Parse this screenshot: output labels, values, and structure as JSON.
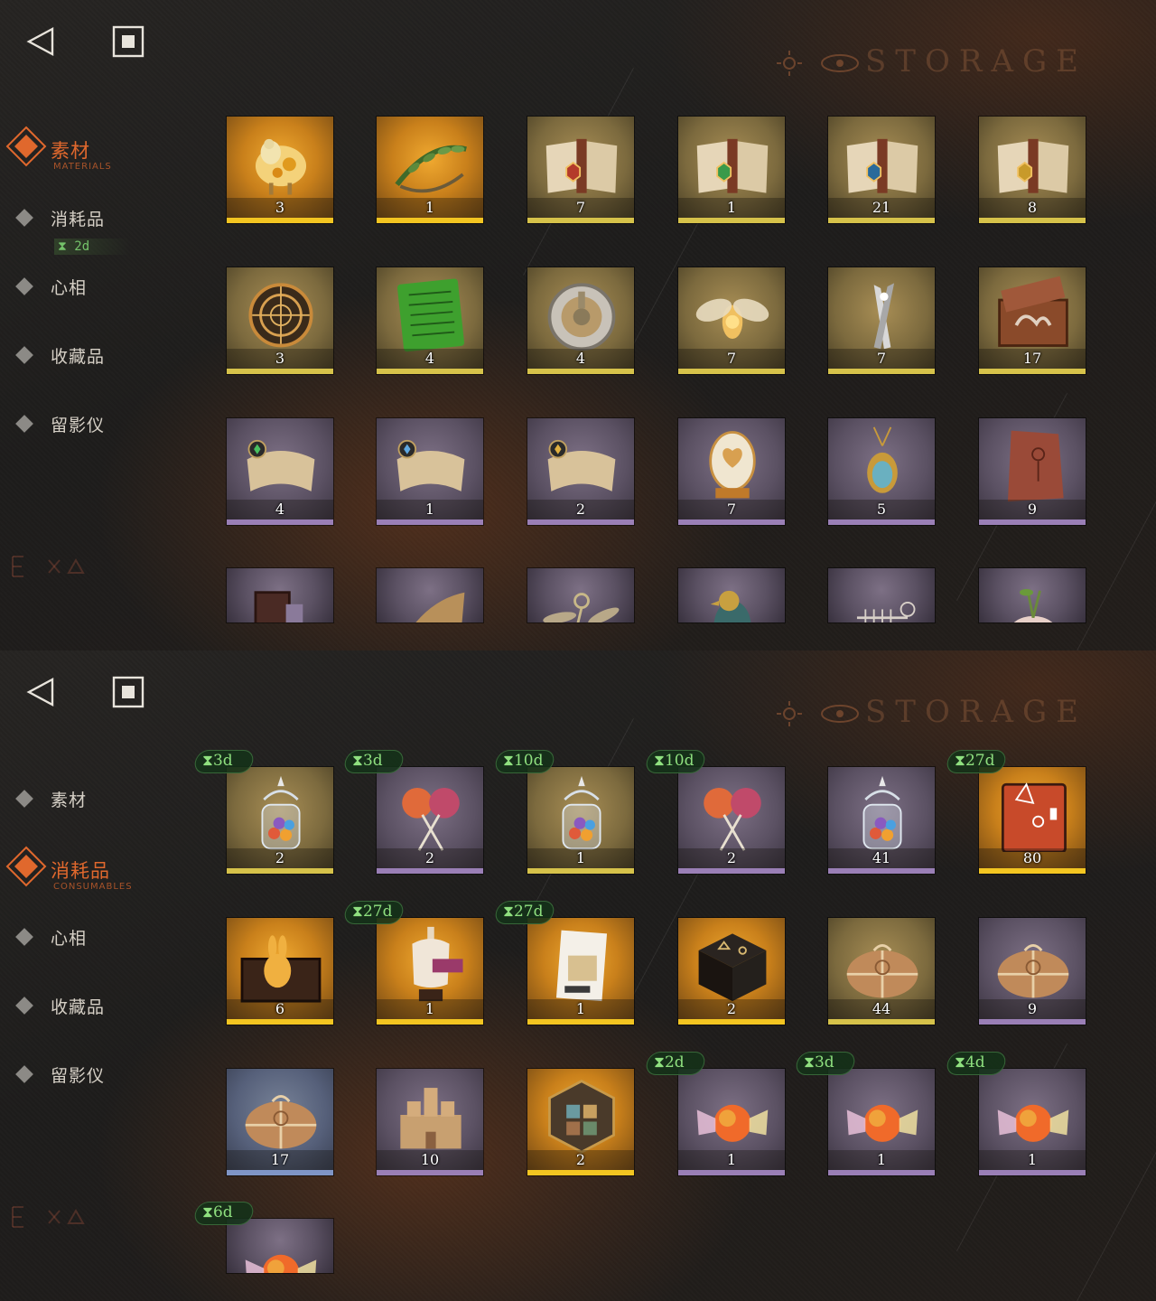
{
  "panels": [
    {
      "header": {
        "back_icon": "back-triangle-icon",
        "home_icon": "home-square-icon",
        "title_decoration": "STORAGE"
      },
      "nav": [
        {
          "label": "素材",
          "sub": "MATERIALS",
          "active": true
        },
        {
          "label": "消耗品",
          "sub": "",
          "active": false,
          "timer": "2d"
        },
        {
          "label": "心相",
          "sub": "",
          "active": false
        },
        {
          "label": "收藏品",
          "sub": "",
          "active": false
        },
        {
          "label": "留影仪",
          "sub": "",
          "active": false
        }
      ],
      "items": [
        {
          "icon": "golden-sheep-icon",
          "count": "3",
          "rarity": "gold"
        },
        {
          "icon": "laurel-wreath-icon",
          "count": "1",
          "rarity": "gold"
        },
        {
          "icon": "open-book-red-icon",
          "count": "7",
          "rarity": "olive"
        },
        {
          "icon": "open-book-green-icon",
          "count": "1",
          "rarity": "olive"
        },
        {
          "icon": "open-book-blue-icon",
          "count": "21",
          "rarity": "olive"
        },
        {
          "icon": "open-book-gold-icon",
          "count": "8",
          "rarity": "olive"
        },
        {
          "icon": "astrolabe-icon",
          "count": "3",
          "rarity": "olive"
        },
        {
          "icon": "green-tablet-icon",
          "count": "4",
          "rarity": "olive"
        },
        {
          "icon": "silver-clockwork-icon",
          "count": "4",
          "rarity": "olive"
        },
        {
          "icon": "glowing-moth-icon",
          "count": "7",
          "rarity": "olive"
        },
        {
          "icon": "crossed-blades-icon",
          "count": "7",
          "rarity": "olive"
        },
        {
          "icon": "case-with-claw-icon",
          "count": "17",
          "rarity": "olive"
        },
        {
          "icon": "scroll-green-icon",
          "count": "4",
          "rarity": "purple"
        },
        {
          "icon": "scroll-blue-icon",
          "count": "1",
          "rarity": "purple"
        },
        {
          "icon": "scroll-gold-icon",
          "count": "2",
          "rarity": "purple"
        },
        {
          "icon": "ornate-egg-icon",
          "count": "7",
          "rarity": "purple"
        },
        {
          "icon": "scarab-pendant-icon",
          "count": "5",
          "rarity": "purple"
        },
        {
          "icon": "clay-tablet-icon",
          "count": "9",
          "rarity": "purple"
        },
        {
          "icon": "wooden-frame-icon",
          "count": "",
          "rarity": "purple"
        },
        {
          "icon": "mechanical-wing-icon",
          "count": "",
          "rarity": "purple"
        },
        {
          "icon": "winged-key-icon",
          "count": "",
          "rarity": "purple"
        },
        {
          "icon": "bronze-bird-icon",
          "count": "",
          "rarity": "purple"
        },
        {
          "icon": "skeleton-animal-icon",
          "count": "",
          "rarity": "purple"
        },
        {
          "icon": "root-plant-icon",
          "count": "",
          "rarity": "purple"
        }
      ]
    },
    {
      "header": {
        "back_icon": "back-triangle-icon",
        "home_icon": "home-square-icon",
        "title_decoration": "STORAGE"
      },
      "nav": [
        {
          "label": "素材",
          "sub": "",
          "active": false
        },
        {
          "label": "消耗品",
          "sub": "CONSUMABLES",
          "active": true
        },
        {
          "label": "心相",
          "sub": "",
          "active": false
        },
        {
          "label": "收藏品",
          "sub": "",
          "active": false
        },
        {
          "label": "留影仪",
          "sub": "",
          "active": false
        }
      ],
      "items": [
        {
          "icon": "candy-jar-icon",
          "count": "2",
          "rarity": "olive",
          "timer": "3d"
        },
        {
          "icon": "lollipops-icon",
          "count": "2",
          "rarity": "purple",
          "timer": "3d"
        },
        {
          "icon": "candy-jar-icon",
          "count": "1",
          "rarity": "olive",
          "timer": "10d"
        },
        {
          "icon": "lollipops-icon",
          "count": "2",
          "rarity": "purple",
          "timer": "10d"
        },
        {
          "icon": "candy-jar-icon",
          "count": "41",
          "rarity": "purple",
          "timer": ""
        },
        {
          "icon": "rune-book-icon",
          "count": "80",
          "rarity": "gold",
          "timer": "27d"
        },
        {
          "icon": "golden-rabbit-box-icon",
          "count": "6",
          "rarity": "gold",
          "timer": ""
        },
        {
          "icon": "tailor-mannequin-icon",
          "count": "1",
          "rarity": "gold",
          "timer": "27d"
        },
        {
          "icon": "shopping-list-icon",
          "count": "1",
          "rarity": "gold",
          "timer": "27d"
        },
        {
          "icon": "rune-table-icon",
          "count": "2",
          "rarity": "gold",
          "timer": ""
        },
        {
          "icon": "parcel-icon",
          "count": "44",
          "rarity": "olive",
          "timer": ""
        },
        {
          "icon": "parcel-icon",
          "count": "9",
          "rarity": "purple",
          "timer": ""
        },
        {
          "icon": "parcel-icon",
          "count": "17",
          "rarity": "blue",
          "timer": ""
        },
        {
          "icon": "sand-castle-icon",
          "count": "10",
          "rarity": "purple",
          "timer": ""
        },
        {
          "icon": "hexagon-puzzle-icon",
          "count": "2",
          "rarity": "gold",
          "timer": ""
        },
        {
          "icon": "wrapped-candy-icon",
          "count": "1",
          "rarity": "purple",
          "timer": "2d"
        },
        {
          "icon": "wrapped-candy-icon",
          "count": "1",
          "rarity": "purple",
          "timer": "3d"
        },
        {
          "icon": "wrapped-candy-icon",
          "count": "1",
          "rarity": "purple",
          "timer": "4d"
        },
        {
          "icon": "wrapped-candy-icon",
          "count": "",
          "rarity": "purple",
          "timer": "6d"
        }
      ]
    }
  ]
}
